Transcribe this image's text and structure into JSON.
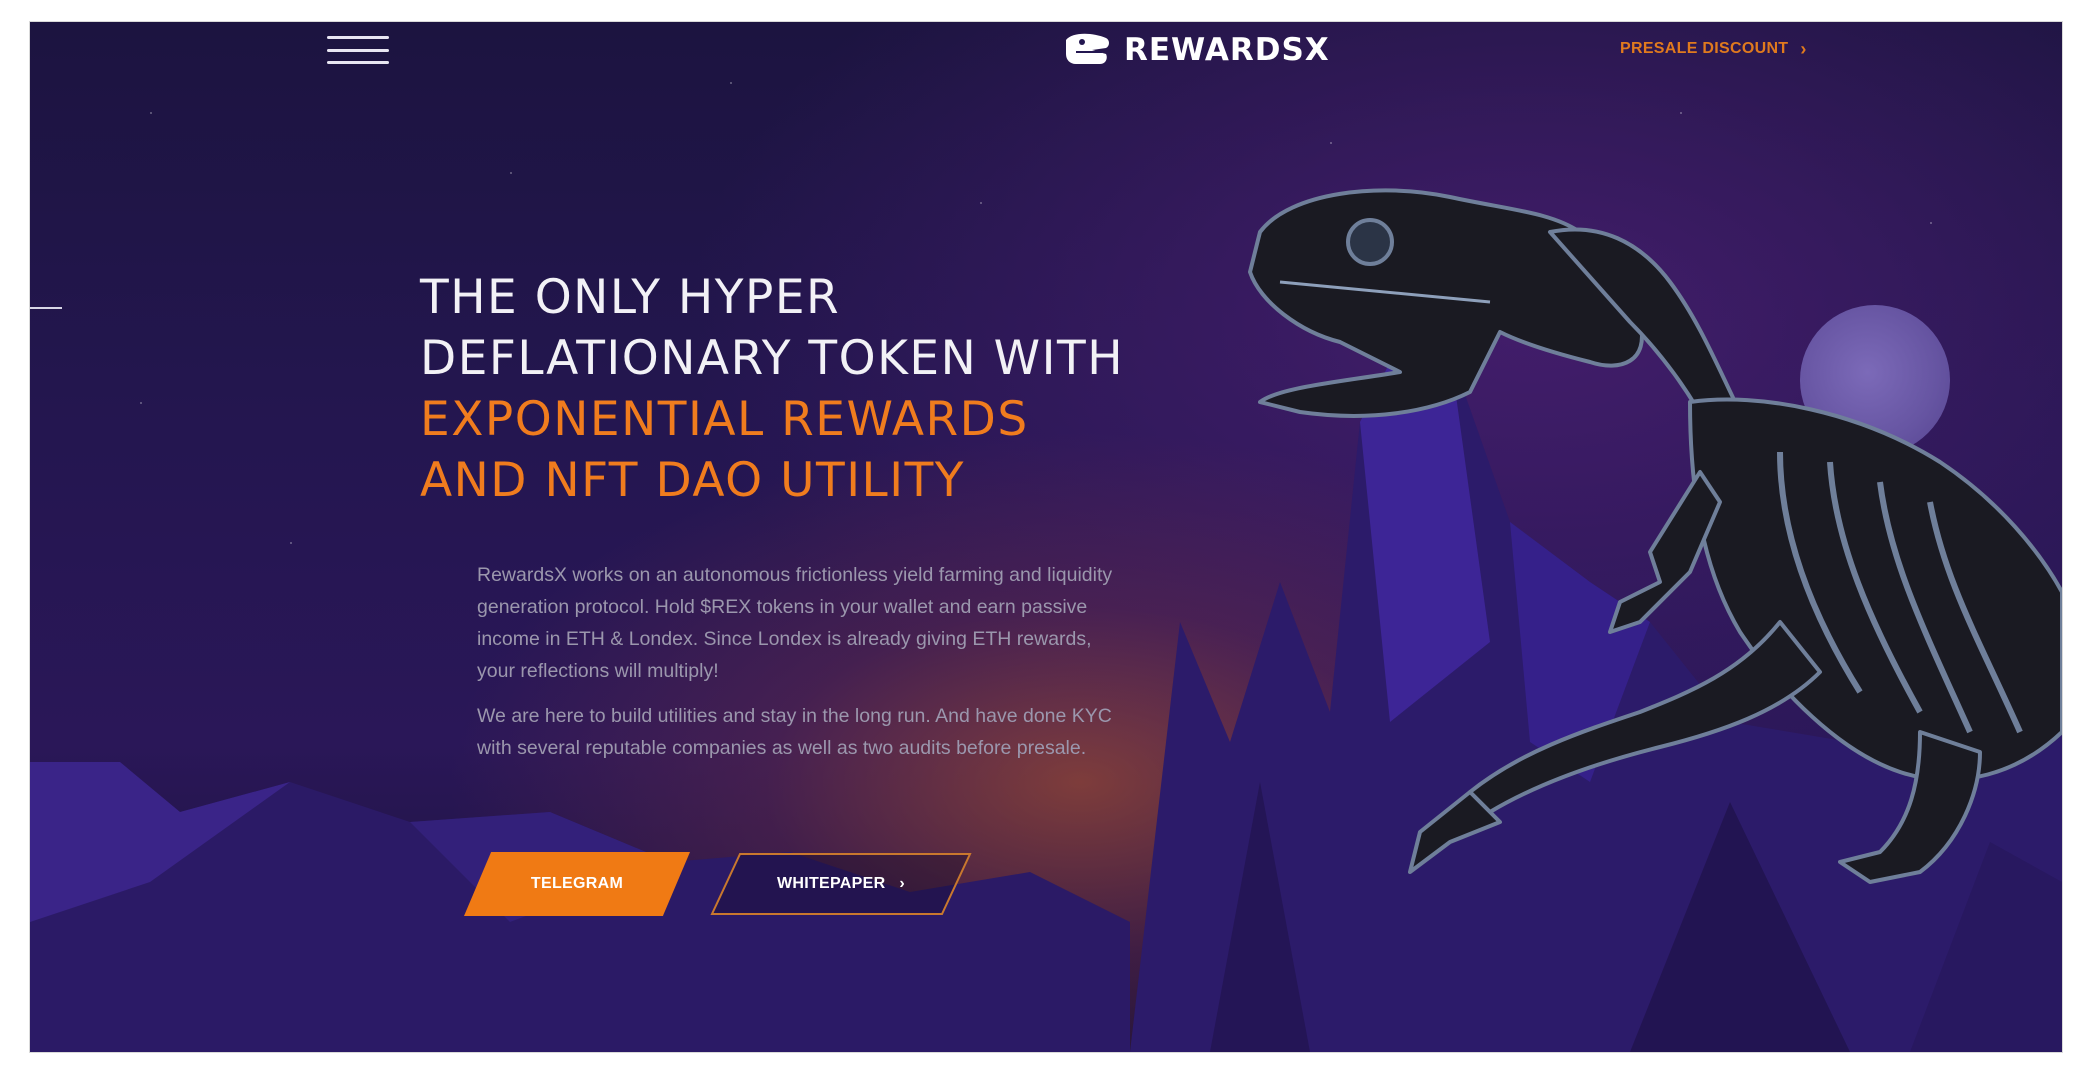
{
  "header": {
    "menu_icon": "hamburger-menu-icon",
    "brand_logo_icon": "dino-skull-icon",
    "brand_name": "REWARDSX",
    "presale_link": "PRESALE DISCOUNT",
    "presale_icon": "chevron-right-icon"
  },
  "hero": {
    "headline_line1": "THE ONLY HYPER",
    "headline_line2": "DEFLATIONARY TOKEN WITH",
    "headline_line3": "EXPONENTIAL REWARDS",
    "headline_line4": "AND NFT DAO UTILITY",
    "paragraph1": "RewardsX works on an autonomous frictionless yield farming and liquidity generation protocol. Hold $REX tokens in your wallet and earn passive income in ETH & Londex. Since Londex is already giving ETH rewards, your reflections will multiply!",
    "paragraph2": "We are here to build utilities and stay in the long run. And have done KYC with several reputable companies as well as two audits before presale."
  },
  "buttons": {
    "telegram": "TELEGRAM",
    "whitepaper": "WHITEPAPER",
    "whitepaper_icon": "chevron-right-icon"
  },
  "colors": {
    "accent": "#f07a14",
    "background": "#231650",
    "headline_white": "#f2f1f6",
    "body_text": "#9b97ad"
  },
  "art": {
    "moon": "moon-illustration",
    "dinosaur": "t-rex-skeleton-illustration",
    "mountains": "purple-mountains-illustration"
  }
}
